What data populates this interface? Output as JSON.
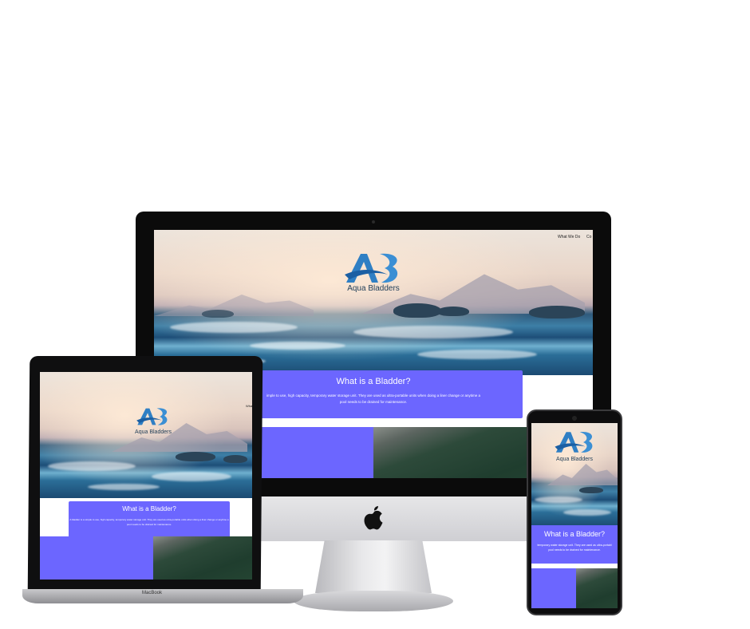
{
  "brand": {
    "name": "Aqua Bladders",
    "accent": "#6c66ff",
    "logo_blue": "#2f7fc4"
  },
  "nav": {
    "item_1": "What We Do",
    "item_2": "Co"
  },
  "section": {
    "heading": "What is a Bladder?",
    "desktop_text_line1": "imple to use, high capacity, temporary water storage unit. They are used as ultra-portable units when doing a liner change or anytime a",
    "desktop_text_line2": "pool needs to be drained for maintenance.",
    "laptop_text_line1": "A bladder is a simple to use, high capacity, temporary water storage unit. They are used as ultra-portable units when doing a liner change or anytime a",
    "laptop_text_line2": "pool needs to be drained for maintenance.",
    "phone_text_line1": "temporary water storage unit. They are used as ultra-portabl",
    "phone_text_line2": "pool needs to be drained for maintenance."
  },
  "laptop": {
    "model_label": "MacBook"
  }
}
